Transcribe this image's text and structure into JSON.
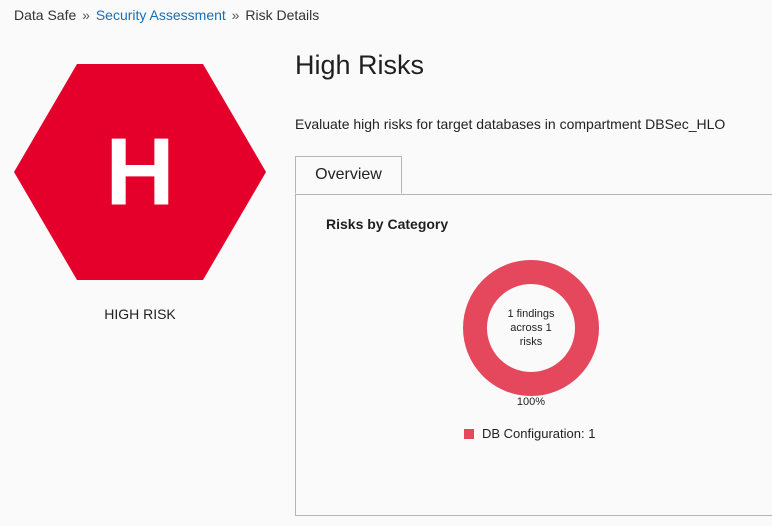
{
  "breadcrumb": {
    "items": [
      "Data Safe",
      "Security Assessment",
      "Risk Details"
    ],
    "separator": "»"
  },
  "risk_badge": {
    "letter": "H",
    "caption": "HIGH RISK",
    "color": "#e4002b"
  },
  "header": {
    "title": "High Risks",
    "description": "Evaluate high risks for target databases in compartment DBSec_HLO"
  },
  "tabs": [
    {
      "label": "Overview",
      "selected": true
    }
  ],
  "overview": {
    "section_title": "Risks by Category",
    "center_text": [
      "1 findings",
      "across 1",
      "risks"
    ],
    "percent_label": "100%",
    "legend": [
      {
        "label": "DB Configuration: 1",
        "color": "#e5485c"
      }
    ]
  },
  "chart_data": {
    "type": "pie",
    "categories": [
      "DB Configuration"
    ],
    "values": [
      1
    ],
    "percent_labels": [
      "100%"
    ],
    "colors": [
      "#e5485c"
    ],
    "title": "Risks by Category",
    "legend_placement": "bottom"
  }
}
